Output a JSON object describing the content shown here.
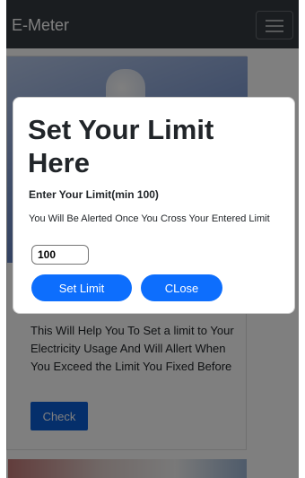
{
  "navbar": {
    "brand": "E-Meter",
    "menu_icon": "hamburger-icon"
  },
  "card": {
    "description": "This Will Help You To Set a limit to Your Electricity Usage And Will Allert When You Exceed the Limit You Fixed Before",
    "check_label": "Check"
  },
  "modal": {
    "title": "Set Your Limit Here",
    "label": "Enter Your Limit(min 100)",
    "note": "You Will Be Alerted Once You Cross Your Entered Limit",
    "input_value": "100",
    "set_label": "Set Limit",
    "close_label": "CLose"
  },
  "colors": {
    "navbar": "#343a40",
    "primary": "#0d6efd"
  }
}
